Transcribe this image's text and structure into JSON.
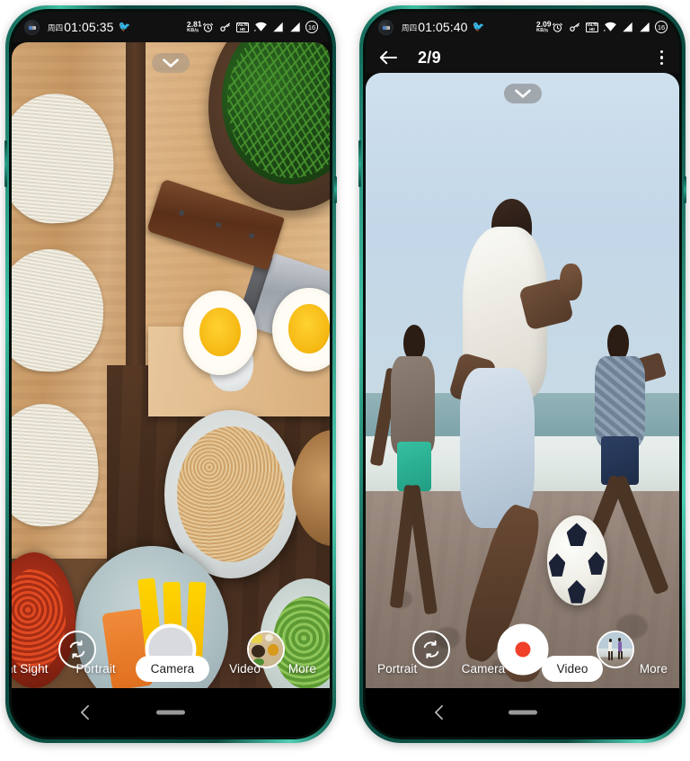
{
  "phones": [
    {
      "id": "camera-photo-mode",
      "status_bar": {
        "weekday": "周四",
        "clock": "01:05:35",
        "net_speed_value": "2.81",
        "net_speed_unit": "KB/s",
        "volte_line1": "VoLTE",
        "volte_line2": "HD",
        "battery_level": "16",
        "icons": [
          "punch-hole-camera",
          "bird-icon",
          "alarm-icon",
          "key-icon",
          "volte-icon",
          "wifi-icon",
          "signal-1-icon",
          "signal-2-icon",
          "battery-icon"
        ]
      },
      "viewfinder": {
        "expand_chevron": "chevron-down",
        "scene": "noodles-knife-eggs-food-flatlay"
      },
      "controls": {
        "flip_camera": "switch-camera",
        "shutter": "shutter-button",
        "thumbnail": "spices-thumbnail"
      },
      "modes": [
        {
          "label": "ht Sight",
          "active": false
        },
        {
          "label": "Portrait",
          "active": false
        },
        {
          "label": "Camera",
          "active": true
        },
        {
          "label": "Video",
          "active": false
        },
        {
          "label": "More",
          "active": false
        }
      ],
      "navbar": {
        "back": "back-chevron",
        "home": "home-indicator"
      }
    },
    {
      "id": "camera-video-mode",
      "status_bar": {
        "weekday": "周四",
        "clock": "01:05:40",
        "net_speed_value": "2.09",
        "net_speed_unit": "KB/s",
        "volte_line1": "VoLTE",
        "volte_line2": "HD",
        "battery_level": "16",
        "icons": [
          "punch-hole-camera",
          "bird-icon",
          "alarm-icon",
          "key-icon",
          "volte-icon",
          "wifi-icon",
          "signal-1-icon",
          "signal-2-icon",
          "battery-icon"
        ]
      },
      "top_bar": {
        "back_label": "back-arrow",
        "title": "2/9",
        "menu_label": "overflow-menu"
      },
      "viewfinder": {
        "expand_chevron": "chevron-down",
        "scene": "beach-football-players"
      },
      "controls": {
        "flip_camera": "switch-camera",
        "shutter": "record-button",
        "thumbnail": "beach-thumbnail"
      },
      "modes": [
        {
          "label": "Portrait",
          "active": false
        },
        {
          "label": "Camera",
          "active": false
        },
        {
          "label": "Video",
          "active": true
        },
        {
          "label": "More",
          "active": false
        }
      ],
      "navbar": {
        "back": "back-chevron",
        "home": "home-indicator"
      }
    }
  ],
  "colors": {
    "frame": "#0f5f52",
    "frame_highlight": "#4fd0b4",
    "status_bg": "#111111",
    "record_red": "#f0402a",
    "active_pill": "#ffffff",
    "nav_bg": "#000000"
  }
}
